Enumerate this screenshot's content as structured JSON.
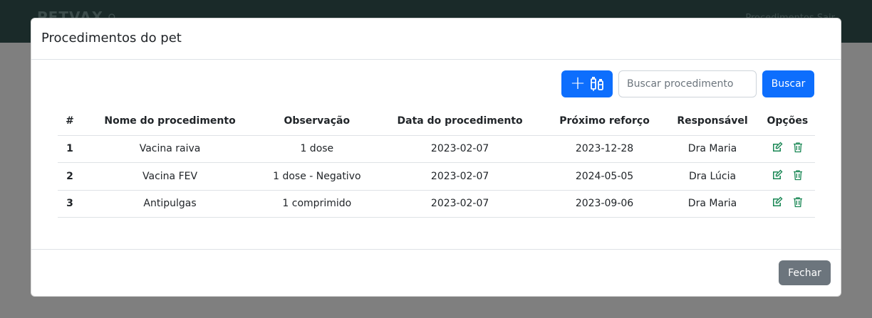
{
  "topbar": {
    "brand": "PETVAX",
    "nav_right": "Procedimentos Sair"
  },
  "modal": {
    "title": "Procedimentos do pet",
    "search_placeholder": "Buscar procedimento",
    "search_button": "Buscar",
    "close_button": "Fechar",
    "add_icon": "plus-vaccine-icon",
    "columns": [
      "#",
      "Nome do procedimento",
      "Observação",
      "Data do procedimento",
      "Próximo reforço",
      "Responsável",
      "Opções"
    ],
    "rows": [
      {
        "n": "1",
        "nome": "Vacina raiva",
        "obs": "1 dose",
        "data": "2023-02-07",
        "reforco": "2023-12-28",
        "resp": "Dra Maria"
      },
      {
        "n": "2",
        "nome": "Vacina FEV",
        "obs": "1 dose - Negativo",
        "data": "2023-02-07",
        "reforco": "2024-05-05",
        "resp": "Dra Lúcia"
      },
      {
        "n": "3",
        "nome": "Antipulgas",
        "obs": "1 comprimido",
        "data": "2023-02-07",
        "reforco": "2023-09-06",
        "resp": "Dra Maria"
      }
    ]
  },
  "colors": {
    "primary": "#0d6efd",
    "secondary": "#6c757d",
    "navbar": "#1a2a29",
    "option_icon": "#198754"
  }
}
